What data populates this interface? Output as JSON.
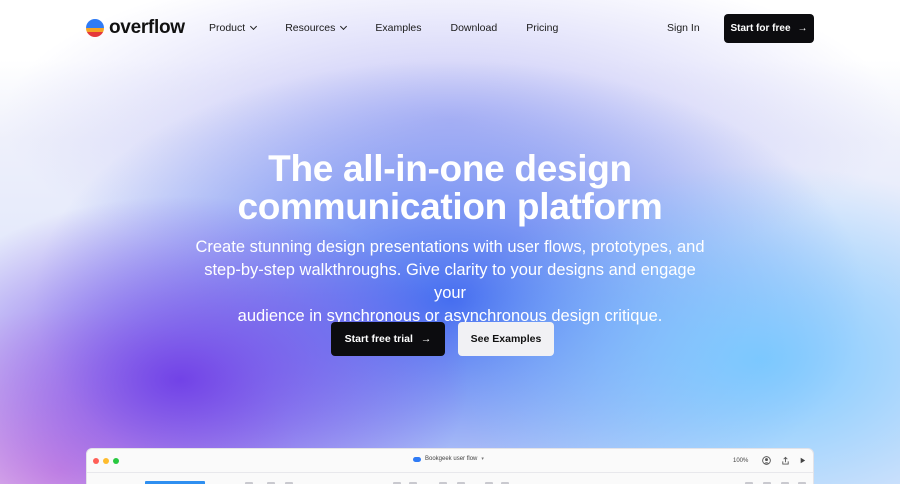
{
  "brand": {
    "name": "overflow"
  },
  "nav": {
    "links": [
      {
        "label": "Product",
        "has_dropdown": true
      },
      {
        "label": "Resources",
        "has_dropdown": true
      },
      {
        "label": "Examples",
        "has_dropdown": false
      },
      {
        "label": "Download",
        "has_dropdown": false
      },
      {
        "label": "Pricing",
        "has_dropdown": false
      }
    ],
    "sign_in": "Sign In",
    "cta": "Start for free",
    "cta_icon": "arrow-right-icon"
  },
  "hero": {
    "title_line1": "The all-in-one design",
    "title_line2": "communication platform",
    "subtitle_line1": "Create stunning design presentations with user flows, prototypes, and",
    "subtitle_line2": "step-by-step walkthroughs. Give clarity to your designs and engage your",
    "subtitle_line3": "audience in synchronous or asynchronous design critique.",
    "primary_button": "Start free trial",
    "secondary_button": "See Examples",
    "arrow": "→"
  },
  "app_preview": {
    "file_name": "Bookgeek user flow",
    "zoom": "100%",
    "window_dot_colors": [
      "#ff5f57",
      "#febc2e",
      "#28c840"
    ],
    "file_icon": "cloud-icon",
    "toolbar_icons": [
      "avatar-icon",
      "share-icon",
      "play-icon"
    ]
  },
  "colors": {
    "primary_button_bg": "#0c0c0f",
    "secondary_button_bg": "#f1f1f4",
    "brand_blue": "#2f7bf5",
    "brand_orange": "#f4a326",
    "brand_red": "#e5383b"
  }
}
